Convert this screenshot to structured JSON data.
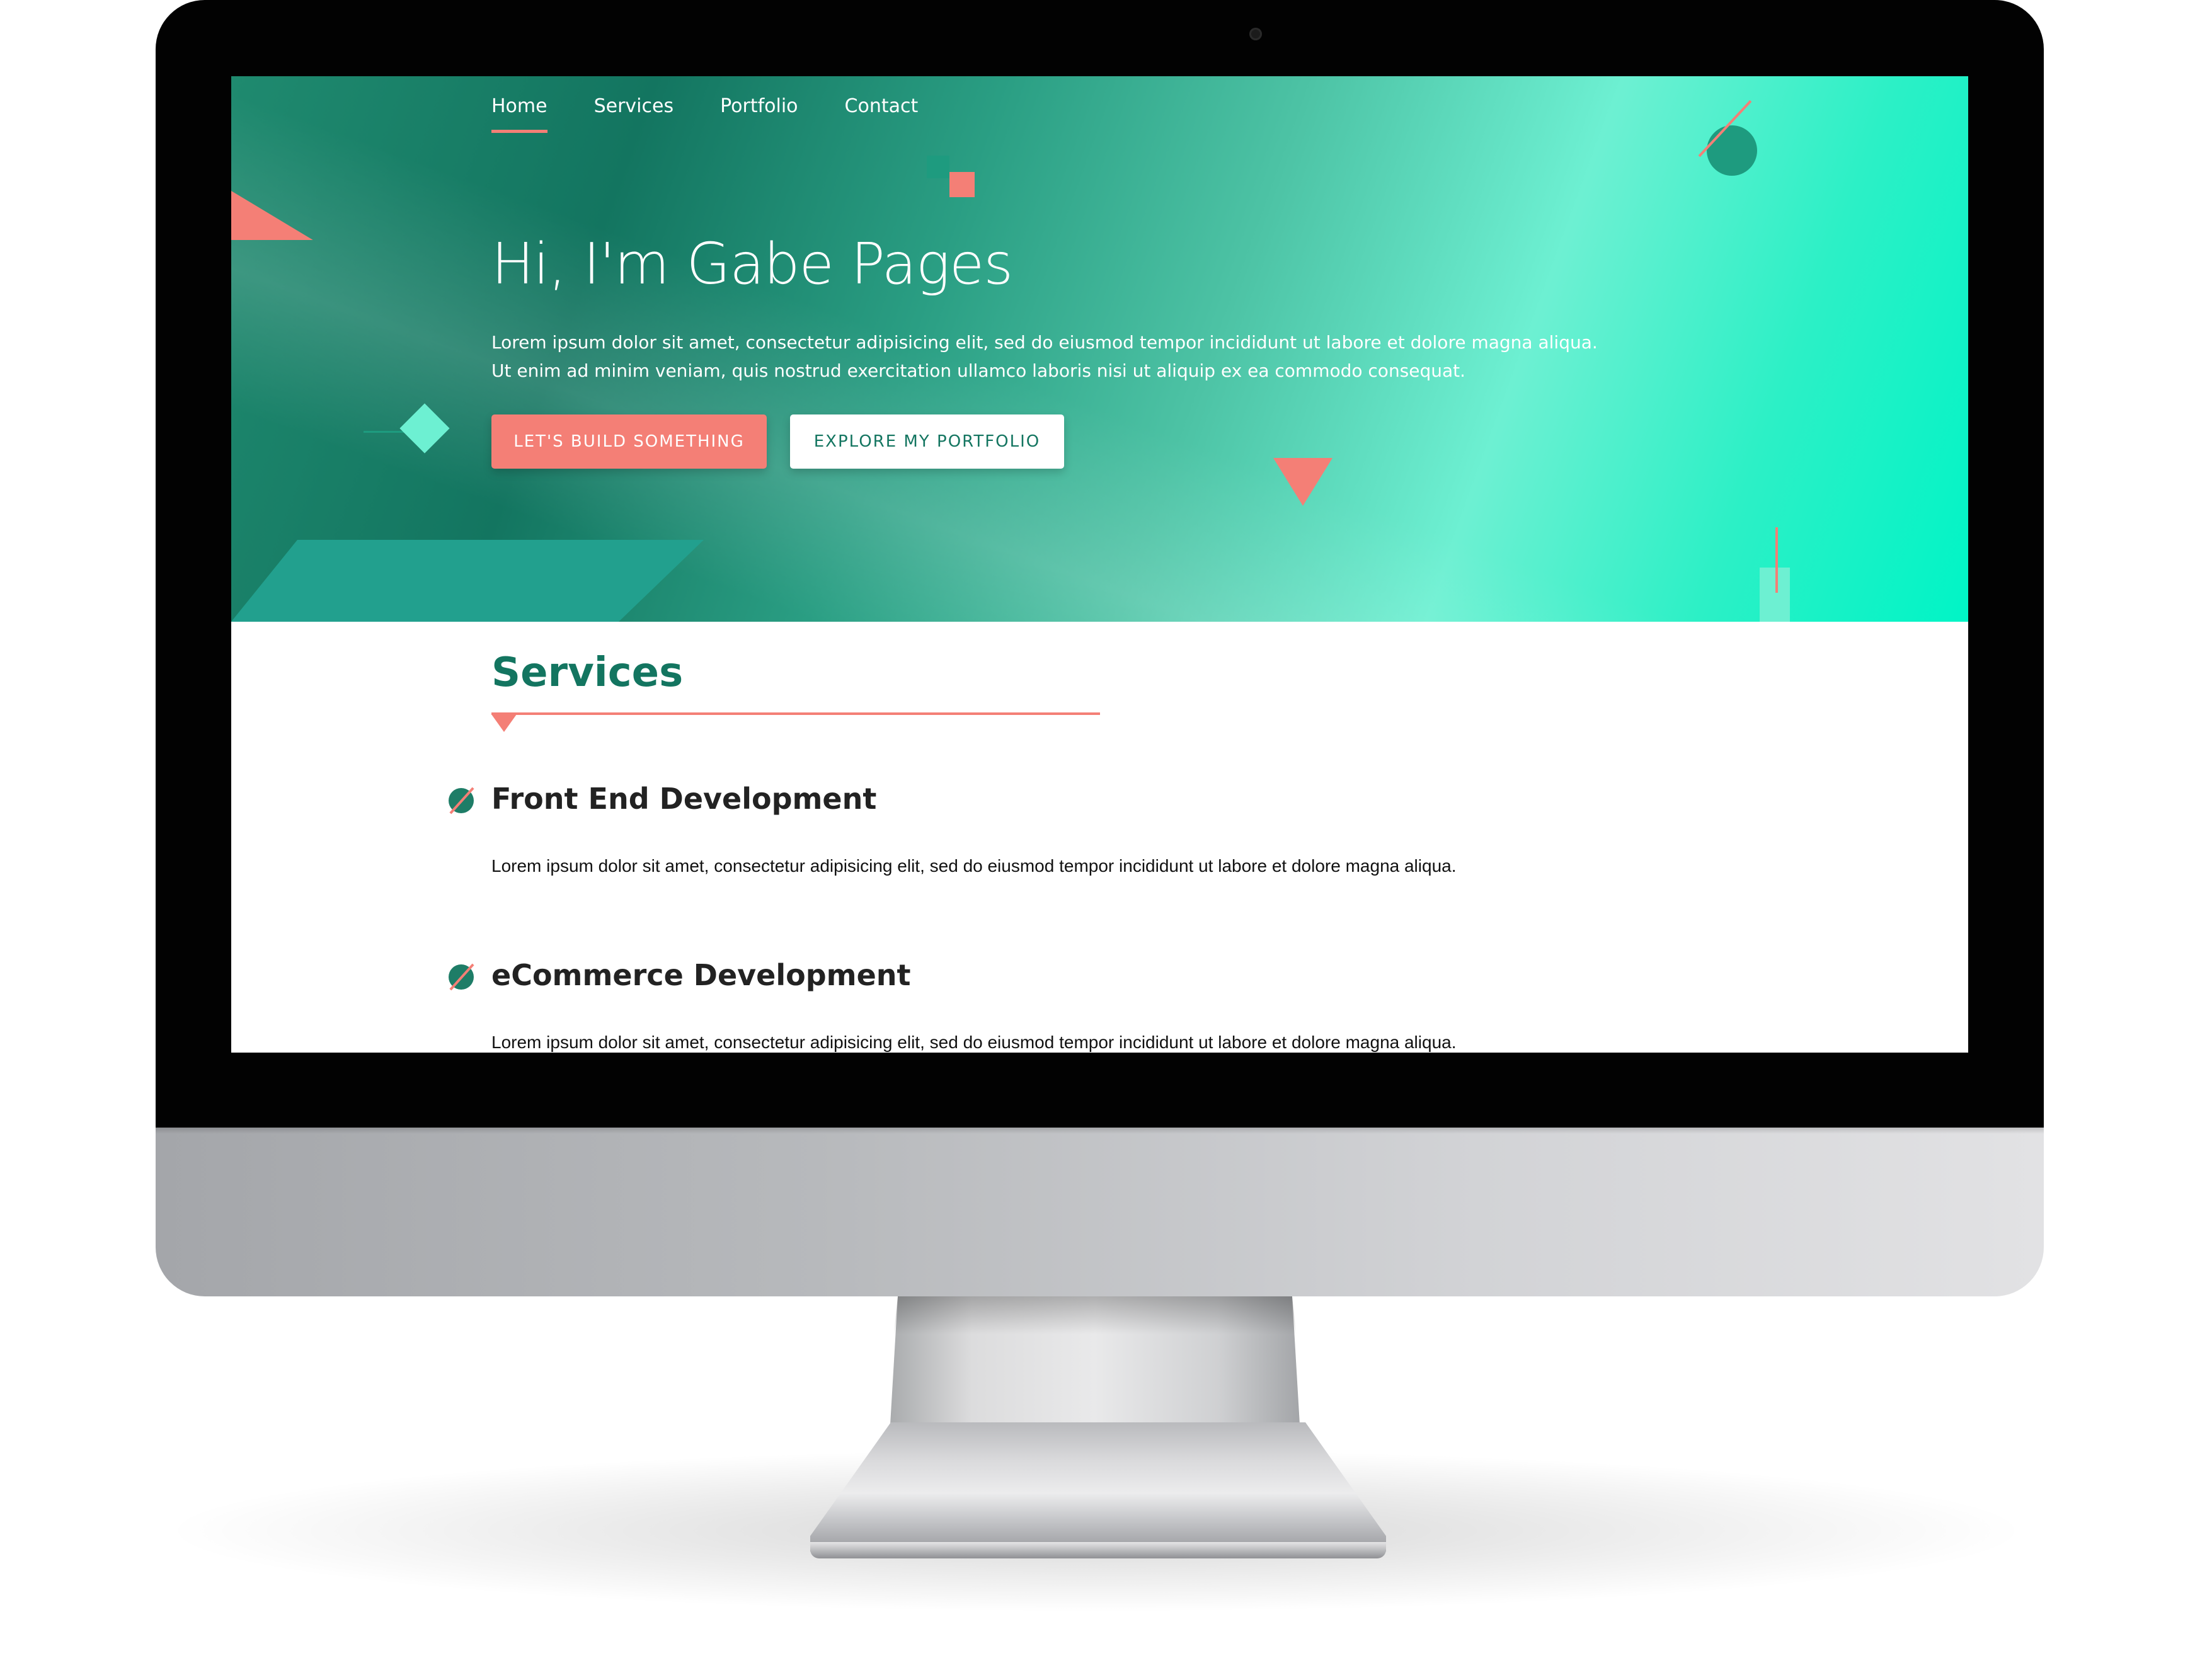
{
  "nav": {
    "items": [
      {
        "label": "Home",
        "active": true
      },
      {
        "label": "Services",
        "active": false
      },
      {
        "label": "Portfolio",
        "active": false
      },
      {
        "label": "Contact",
        "active": false
      }
    ]
  },
  "hero": {
    "title": "Hi, I'm Gabe Pages",
    "text": "Lorem ipsum dolor sit amet, consectetur adipisicing elit, sed do eiusmod tempor incididunt ut labore et dolore magna aliqua. Ut enim ad minim veniam, quis nostrud exercitation ullamco laboris nisi ut aliquip ex ea commodo consequat.",
    "primary_button": "LET'S BUILD SOMETHING",
    "secondary_button": "EXPLORE MY PORTFOLIO"
  },
  "services": {
    "title": "Services",
    "items": [
      {
        "title": "Front End Development",
        "text": "Lorem ipsum dolor sit amet, consectetur adipisicing elit, sed do eiusmod tempor incididunt ut labore et dolore magna aliqua."
      },
      {
        "title": "eCommerce Development",
        "text": "Lorem ipsum dolor sit amet, consectetur adipisicing elit, sed do eiusmod tempor incididunt ut labore et dolore magna aliqua."
      }
    ]
  },
  "colors": {
    "accent": "#f47f76",
    "brand_dark": "#137560",
    "brand_light": "#6df0d2"
  }
}
